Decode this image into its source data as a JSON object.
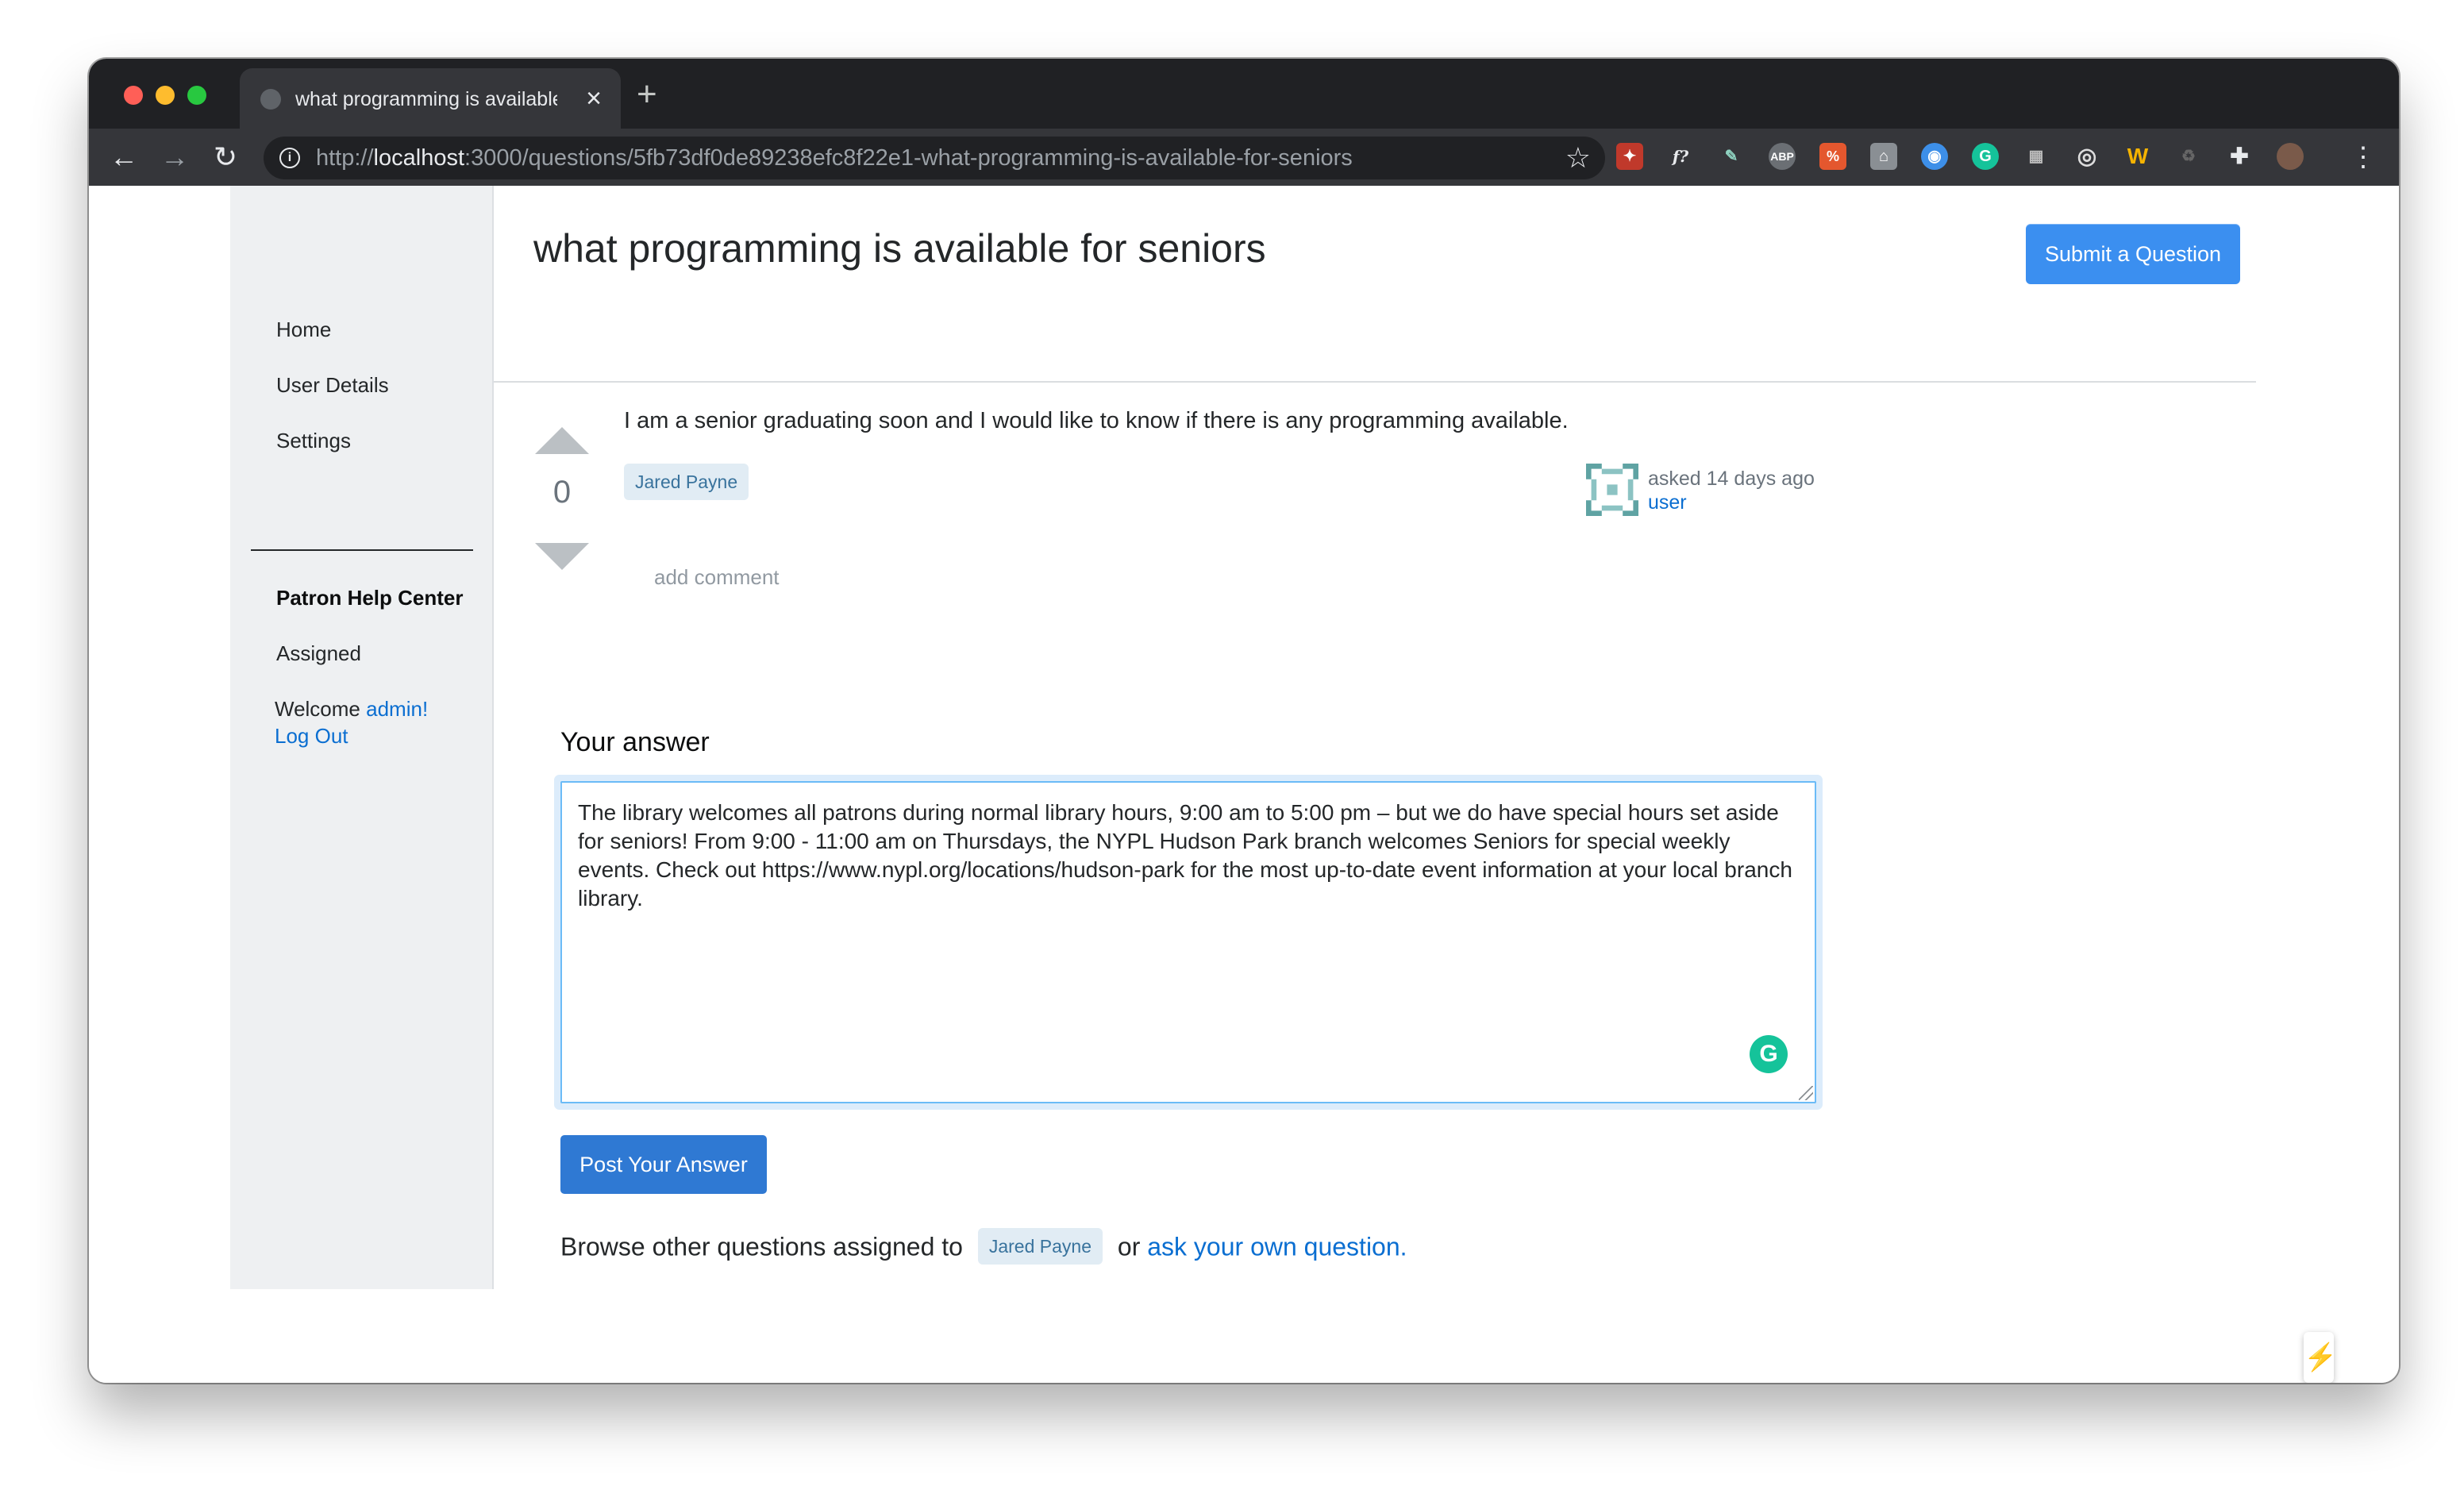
{
  "browser": {
    "tab_title": "what programming is available for seniors",
    "url_scheme": "http://",
    "url_host": "localhost",
    "url_rest": ":3000/questions/5fb73df0de89238efc8f22e1-what-programming-is-available-for-seniors"
  },
  "sidebar": {
    "nav": [
      "Home",
      "User Details",
      "Settings"
    ],
    "section_title": "Patron Help Center",
    "section_link": "Assigned",
    "welcome_text": "Welcome",
    "username": "admin!",
    "logout": "Log Out"
  },
  "header": {
    "title": "what programming is available for seniors",
    "submit_button": "Submit a Question"
  },
  "question": {
    "votes": "0",
    "body": "I am a senior graduating soon and I would like to know if there is any programming available.",
    "tag": "Jared Payne",
    "asked": "asked 14 days ago",
    "asker": "user",
    "add_comment": "add comment"
  },
  "answer": {
    "label": "Your answer",
    "text": "The library welcomes all patrons during normal library hours, 9:00 am to 5:00 pm – but we do have special hours set aside for seniors! From 9:00 - 11:00 am on Thursdays, the NYPL Hudson Park branch welcomes Seniors for special weekly events. Check out https://www.nypl.org/locations/hudson-park for the most up-to-date event information at your local branch library.",
    "post_button": "Post Your Answer"
  },
  "footer": {
    "browse_prefix": "Browse other questions assigned to",
    "browse_tag": "Jared Payne",
    "or_text": "or",
    "ask_link": "ask your own question."
  },
  "colors": {
    "accent": "#3b8ff0",
    "post_button": "#2f79d3",
    "link": "#0a6ed1",
    "tag_bg": "#e1ecf4",
    "tag_fg": "#39739d"
  }
}
